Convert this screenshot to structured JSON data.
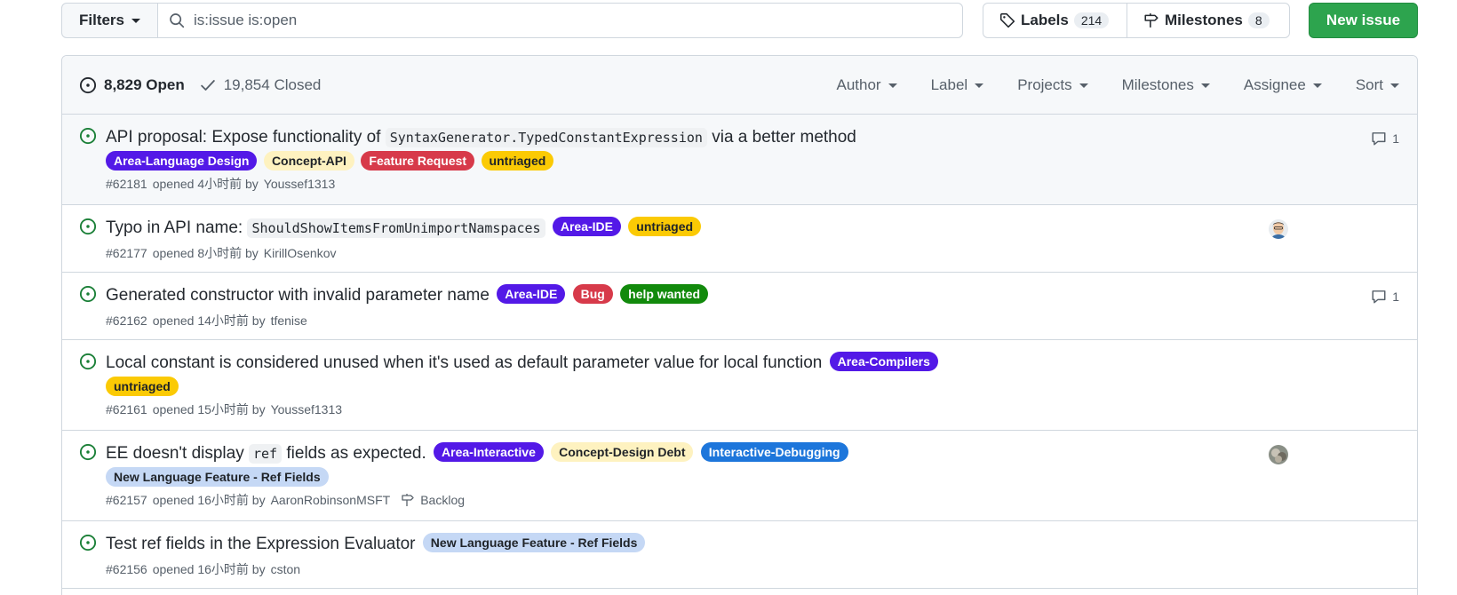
{
  "toolbar": {
    "filters_label": "Filters",
    "search_value": "is:issue is:open",
    "labels_label": "Labels",
    "labels_count": "214",
    "milestones_label": "Milestones",
    "milestones_count": "8",
    "new_issue_label": "New issue"
  },
  "header": {
    "open_label": "8,829 Open",
    "closed_label": "19,854 Closed",
    "filters": [
      "Author",
      "Label",
      "Projects",
      "Milestones",
      "Assignee",
      "Sort"
    ]
  },
  "colors": {
    "open_green": "#1a7f37",
    "primary_button": "#2da44e"
  },
  "issues": [
    {
      "title_pre": "API proposal: Expose functionality of ",
      "title_code": "SyntaxGenerator.TypedConstantExpression",
      "title_post": " via a better method",
      "labels": [
        {
          "name": "Area-Language Design",
          "bg": "#5319e7",
          "fg": "#ffffff"
        },
        {
          "name": "Concept-API",
          "bg": "#fef2c0",
          "fg": "#1f2328"
        },
        {
          "name": "Feature Request",
          "bg": "#d73a4a",
          "fg": "#ffffff"
        },
        {
          "name": "untriaged",
          "bg": "#fbca04",
          "fg": "#1f2328"
        }
      ],
      "meta_number": "#62181",
      "meta_opened": "opened 4小时前 by",
      "meta_author": "Youssef1313",
      "comments": "1"
    },
    {
      "title_pre": "Typo in API name: ",
      "title_code": "ShouldShowItemsFromUnimportNamspaces",
      "inline_labels": [
        {
          "name": "Area-IDE",
          "bg": "#5319e7",
          "fg": "#ffffff"
        },
        {
          "name": "untriaged",
          "bg": "#fbca04",
          "fg": "#1f2328"
        }
      ],
      "meta_number": "#62177",
      "meta_opened": "opened 8小时前 by",
      "meta_author": "KirillOsenkov"
    },
    {
      "title_pre": "Generated constructor with invalid parameter name",
      "inline_labels": [
        {
          "name": "Area-IDE",
          "bg": "#5319e7",
          "fg": "#ffffff"
        },
        {
          "name": "Bug",
          "bg": "#d73a4a",
          "fg": "#ffffff"
        },
        {
          "name": "help wanted",
          "bg": "#128a0c",
          "fg": "#ffffff"
        }
      ],
      "meta_number": "#62162",
      "meta_opened": "opened 14小时前 by",
      "meta_author": "tfenise",
      "comments": "1"
    },
    {
      "title_pre": "Local constant is considered unused when it's used as default parameter value for local function",
      "inline_labels": [
        {
          "name": "Area-Compilers",
          "bg": "#5319e7",
          "fg": "#ffffff"
        }
      ],
      "labels": [
        {
          "name": "untriaged",
          "bg": "#fbca04",
          "fg": "#1f2328"
        }
      ],
      "meta_number": "#62161",
      "meta_opened": "opened 15小时前 by",
      "meta_author": "Youssef1313"
    },
    {
      "title_pre": "EE doesn't display ",
      "title_code": "ref",
      "title_post": " fields as expected.",
      "inline_labels": [
        {
          "name": "Area-Interactive",
          "bg": "#5319e7",
          "fg": "#ffffff"
        },
        {
          "name": "Concept-Design Debt",
          "bg": "#fef2c0",
          "fg": "#1f2328"
        },
        {
          "name": "Interactive-Debugging",
          "bg": "#1d76db",
          "fg": "#ffffff"
        }
      ],
      "labels": [
        {
          "name": "New Language Feature - Ref Fields",
          "bg": "#c5d8f5",
          "fg": "#1f2328"
        }
      ],
      "meta_number": "#62157",
      "meta_opened": "opened 16小时前 by",
      "meta_author": "AaronRobinsonMSFT",
      "milestone": "Backlog"
    },
    {
      "title_pre": "Test ref fields in the Expression Evaluator",
      "inline_labels": [
        {
          "name": "New Language Feature - Ref Fields",
          "bg": "#c5d8f5",
          "fg": "#1f2328"
        }
      ],
      "meta_number": "#62156",
      "meta_opened": "opened 16小时前 by",
      "meta_author": "cston"
    }
  ]
}
